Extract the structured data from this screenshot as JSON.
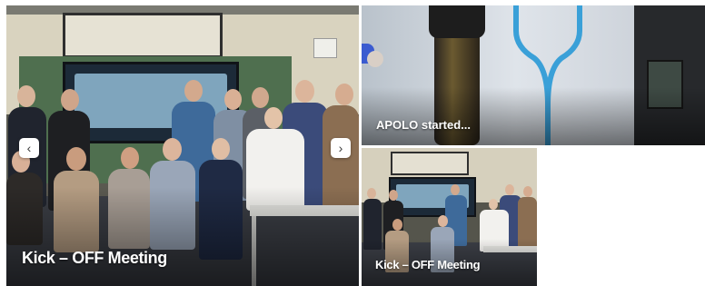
{
  "carousel": {
    "main_slide": {
      "title": "Kick – OFF Meeting"
    },
    "prev_icon": "chevron-left-icon",
    "next_icon": "chevron-right-icon",
    "prev_glyph": "‹",
    "next_glyph": "›"
  },
  "side_cards": [
    {
      "title": "APOLO started..."
    },
    {
      "title": "Kick – OFF Meeting"
    }
  ],
  "colors": {
    "caption_text": "#ffffff",
    "nav_button_bg": "#ffffff",
    "page_bg": "#ffffff"
  }
}
